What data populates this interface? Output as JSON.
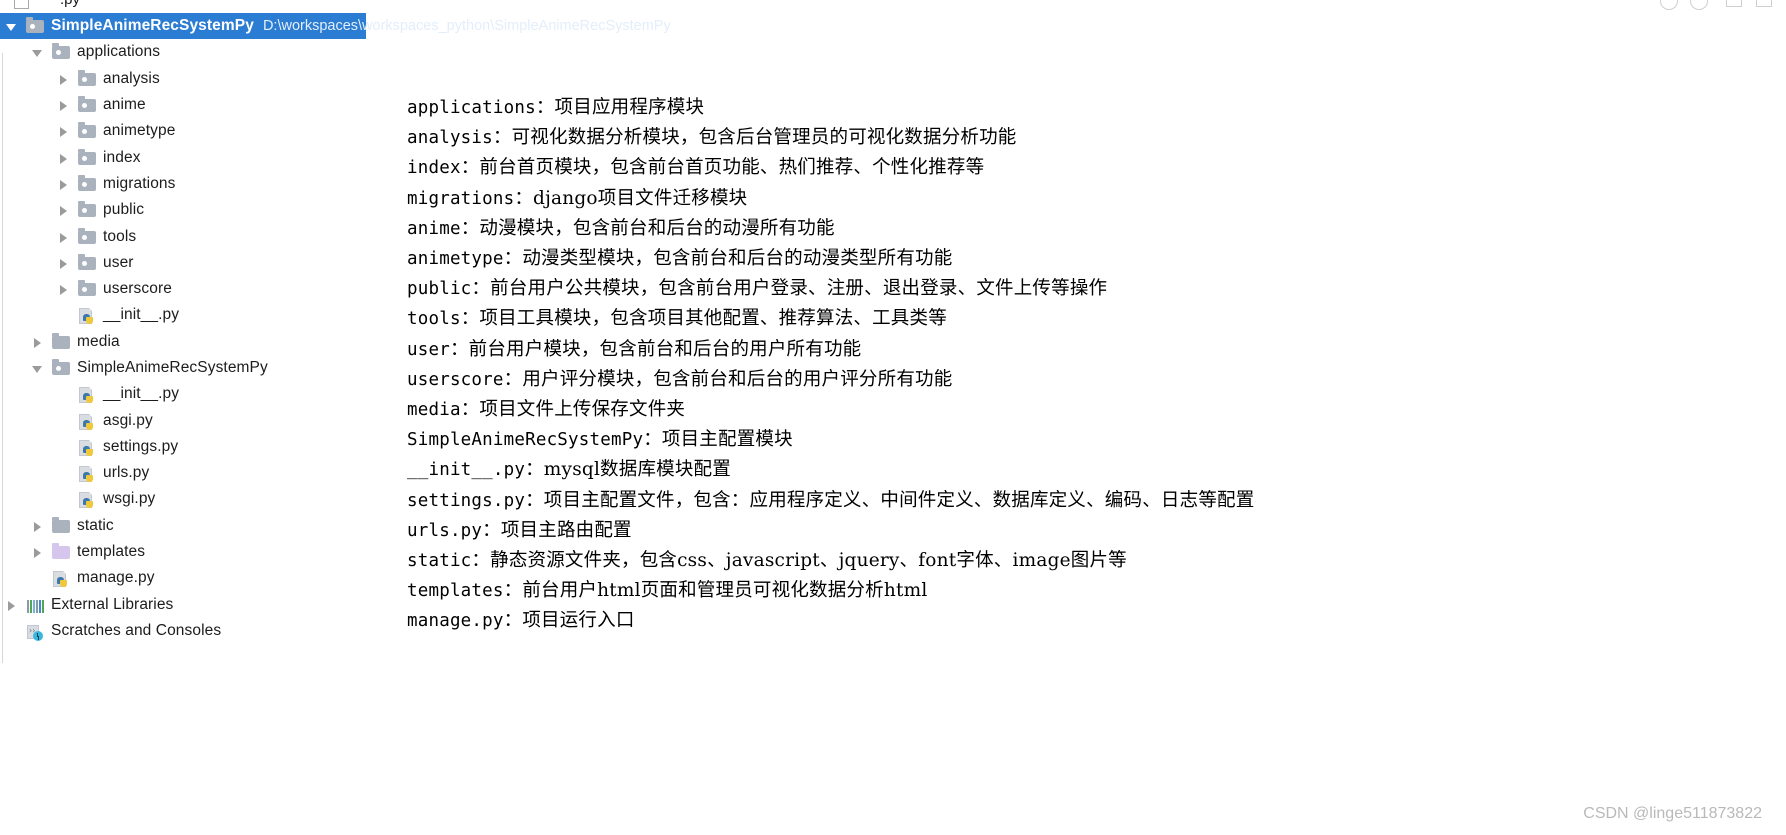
{
  "window": {
    "top_strip_text": ".py",
    "watermark": "CSDN @linge511873822"
  },
  "project_tree": {
    "root": {
      "label": "SimpleAnimeRecSystemPy",
      "path": "D:\\workspaces\\workspaces_python\\SimpleAnimeRecSystemPy",
      "selected": true,
      "arrow": "expanded",
      "icon": "folder-source-icon"
    },
    "items": [
      {
        "label": "applications",
        "indent": 1,
        "arrow": "expanded",
        "icon": "folder-source-icon"
      },
      {
        "label": "analysis",
        "indent": 2,
        "arrow": "collapsed",
        "icon": "folder-source-icon"
      },
      {
        "label": "anime",
        "indent": 2,
        "arrow": "collapsed",
        "icon": "folder-source-icon"
      },
      {
        "label": "animetype",
        "indent": 2,
        "arrow": "collapsed",
        "icon": "folder-source-icon"
      },
      {
        "label": "index",
        "indent": 2,
        "arrow": "collapsed",
        "icon": "folder-source-icon"
      },
      {
        "label": "migrations",
        "indent": 2,
        "arrow": "collapsed",
        "icon": "folder-source-icon"
      },
      {
        "label": "public",
        "indent": 2,
        "arrow": "collapsed",
        "icon": "folder-source-icon"
      },
      {
        "label": "tools",
        "indent": 2,
        "arrow": "collapsed",
        "icon": "folder-source-icon"
      },
      {
        "label": "user",
        "indent": 2,
        "arrow": "collapsed",
        "icon": "folder-source-icon"
      },
      {
        "label": "userscore",
        "indent": 2,
        "arrow": "collapsed",
        "icon": "folder-source-icon"
      },
      {
        "label": "__init__.py",
        "indent": 2,
        "arrow": "none",
        "icon": "python-file-icon"
      },
      {
        "label": "media",
        "indent": 1,
        "arrow": "collapsed",
        "icon": "folder-plain-icon"
      },
      {
        "label": "SimpleAnimeRecSystemPy",
        "indent": 1,
        "arrow": "expanded",
        "icon": "folder-source-icon"
      },
      {
        "label": "__init__.py",
        "indent": 2,
        "arrow": "none",
        "icon": "python-file-icon"
      },
      {
        "label": "asgi.py",
        "indent": 2,
        "arrow": "none",
        "icon": "python-file-icon"
      },
      {
        "label": "settings.py",
        "indent": 2,
        "arrow": "none",
        "icon": "python-file-icon"
      },
      {
        "label": "urls.py",
        "indent": 2,
        "arrow": "none",
        "icon": "python-file-icon"
      },
      {
        "label": "wsgi.py",
        "indent": 2,
        "arrow": "none",
        "icon": "python-file-icon"
      },
      {
        "label": "static",
        "indent": 1,
        "arrow": "collapsed",
        "icon": "folder-plain-icon"
      },
      {
        "label": "templates",
        "indent": 1,
        "arrow": "collapsed",
        "icon": "folder-templates-icon"
      },
      {
        "label": "manage.py",
        "indent": 1,
        "arrow": "none",
        "icon": "python-file-icon"
      },
      {
        "label": "External Libraries",
        "indent": 0,
        "arrow": "collapsed",
        "icon": "external-libraries-icon"
      },
      {
        "label": "Scratches and Consoles",
        "indent": 0,
        "arrow": "none",
        "icon": "scratches-icon"
      }
    ]
  },
  "description": {
    "lines": [
      {
        "name": "applications",
        "desc": "：项目应用程序模块"
      },
      {
        "name": "analysis",
        "desc": "：可视化数据分析模块，包含后台管理员的可视化数据分析功能"
      },
      {
        "name": "index",
        "desc": "：前台首页模块，包含前台首页功能、热们推荐、个性化推荐等"
      },
      {
        "name": "migrations",
        "desc": "：django项目文件迁移模块"
      },
      {
        "name": "anime",
        "desc": "：动漫模块，包含前台和后台的动漫所有功能"
      },
      {
        "name": "animetype",
        "desc": "：动漫类型模块，包含前台和后台的动漫类型所有功能"
      },
      {
        "name": "public",
        "desc": "：前台用户公共模块，包含前台用户登录、注册、退出登录、文件上传等操作"
      },
      {
        "name": "tools",
        "desc": "：项目工具模块，包含项目其他配置、推荐算法、工具类等"
      },
      {
        "name": "user",
        "desc": "：前台用户模块，包含前台和后台的用户所有功能"
      },
      {
        "name": "userscore",
        "desc": "：用户评分模块，包含前台和后台的用户评分所有功能"
      },
      {
        "name": "media",
        "desc": "：项目文件上传保存文件夹"
      },
      {
        "name": "SimpleAnimeRecSystemPy",
        "desc": "：项目主配置模块"
      },
      {
        "name": "__init__.py",
        "desc": "：mysql数据库模块配置"
      },
      {
        "name": "settings.py",
        "desc": "：项目主配置文件，包含：应用程序定义、中间件定义、数据库定义、编码、日志等配置"
      },
      {
        "name": "urls.py",
        "desc": "：项目主路由配置"
      },
      {
        "name": "static",
        "desc": "：静态资源文件夹，包含css、javascript、jquery、font字体、image图片等"
      },
      {
        "name": "templates",
        "desc": "：前台用户html页面和管理员可视化数据分析html"
      },
      {
        "name": "manage.py",
        "desc": "：项目运行入口"
      }
    ]
  }
}
